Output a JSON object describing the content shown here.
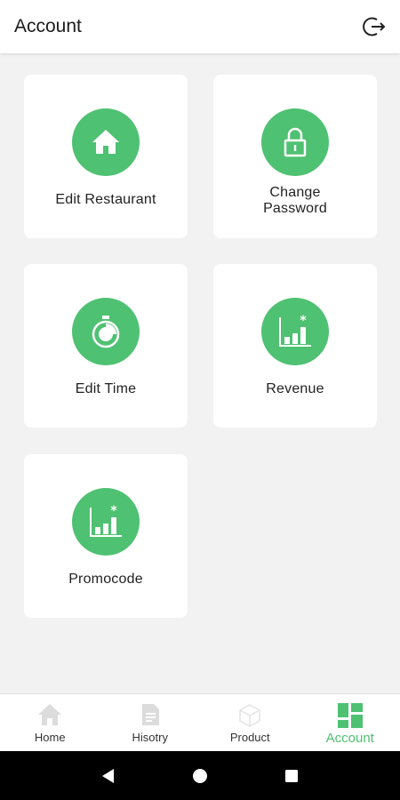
{
  "header": {
    "title": "Account",
    "logout_icon": "logout-icon"
  },
  "cards": [
    {
      "label": "Edit Restaurant",
      "icon": "home-icon"
    },
    {
      "label": "Change Password",
      "icon": "lock-icon"
    },
    {
      "label": "Edit Time",
      "icon": "stopwatch-icon"
    },
    {
      "label": "Revenue",
      "icon": "bar-chart-star-icon"
    },
    {
      "label": "Promocode",
      "icon": "bar-chart-star-icon"
    }
  ],
  "nav": {
    "items": [
      {
        "label": "Home",
        "icon": "home-icon",
        "active": false
      },
      {
        "label": "Hisotry",
        "icon": "document-icon",
        "active": false
      },
      {
        "label": "Product",
        "icon": "box-icon",
        "active": false
      },
      {
        "label": "Account",
        "icon": "grid-icon",
        "active": true
      }
    ]
  },
  "system_nav": {
    "buttons": [
      "back-icon",
      "home-circle-icon",
      "recents-icon"
    ]
  },
  "colors": {
    "accent": "#4fc172",
    "background": "#f2f2f2",
    "inactive_icon": "#dcdcdc"
  }
}
